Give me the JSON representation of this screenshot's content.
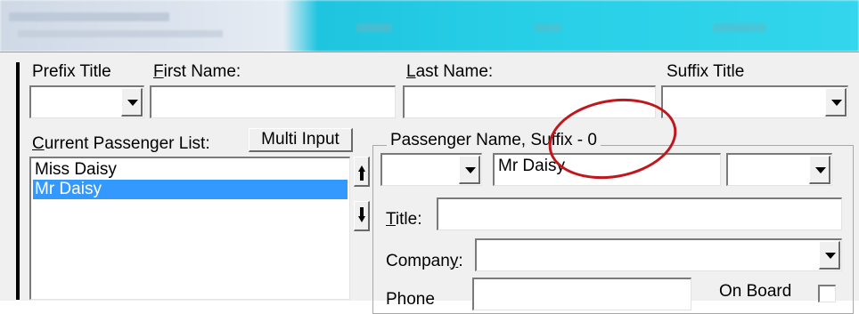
{
  "form": {
    "prefix_title_label": "Prefix Title",
    "first_name_label": "First Name:",
    "first_name_value": "",
    "last_name_label": "Last Name:",
    "last_name_value": "",
    "suffix_title_label": "Suffix Title",
    "prefix_value": "",
    "suffix_value": ""
  },
  "list": {
    "label": "Current Passenger List:",
    "multi_input_label": "Multi Input",
    "items": [
      "Miss Daisy",
      "Mr Daisy"
    ],
    "selected_index": 1
  },
  "passenger_group": {
    "title": "Passenger Name, Suffix - 0",
    "prefix_value": "",
    "name_value": "Mr Daisy",
    "suffix_value": "",
    "title_label": "Title:",
    "title_value": "",
    "company_label": "Company:",
    "company_value": "",
    "phone_label": "Phone",
    "phone_value": "",
    "on_board_label": "On Board",
    "on_board_checked": false
  },
  "annotation": {
    "color": "#c0171d"
  }
}
